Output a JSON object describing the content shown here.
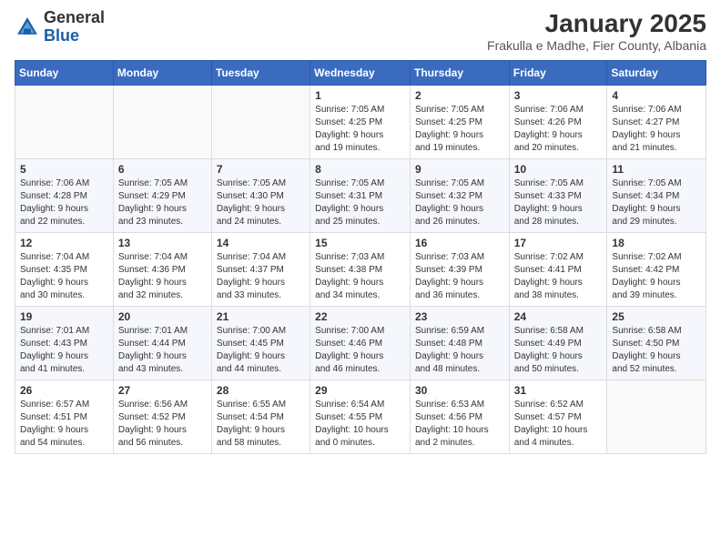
{
  "header": {
    "logo_general": "General",
    "logo_blue": "Blue",
    "month_year": "January 2025",
    "location": "Frakulla e Madhe, Fier County, Albania"
  },
  "days_of_week": [
    "Sunday",
    "Monday",
    "Tuesday",
    "Wednesday",
    "Thursday",
    "Friday",
    "Saturday"
  ],
  "weeks": [
    [
      {
        "day": "",
        "info": ""
      },
      {
        "day": "",
        "info": ""
      },
      {
        "day": "",
        "info": ""
      },
      {
        "day": "1",
        "info": "Sunrise: 7:05 AM\nSunset: 4:25 PM\nDaylight: 9 hours\nand 19 minutes."
      },
      {
        "day": "2",
        "info": "Sunrise: 7:05 AM\nSunset: 4:25 PM\nDaylight: 9 hours\nand 19 minutes."
      },
      {
        "day": "3",
        "info": "Sunrise: 7:06 AM\nSunset: 4:26 PM\nDaylight: 9 hours\nand 20 minutes."
      },
      {
        "day": "4",
        "info": "Sunrise: 7:06 AM\nSunset: 4:27 PM\nDaylight: 9 hours\nand 21 minutes."
      }
    ],
    [
      {
        "day": "5",
        "info": "Sunrise: 7:06 AM\nSunset: 4:28 PM\nDaylight: 9 hours\nand 22 minutes."
      },
      {
        "day": "6",
        "info": "Sunrise: 7:05 AM\nSunset: 4:29 PM\nDaylight: 9 hours\nand 23 minutes."
      },
      {
        "day": "7",
        "info": "Sunrise: 7:05 AM\nSunset: 4:30 PM\nDaylight: 9 hours\nand 24 minutes."
      },
      {
        "day": "8",
        "info": "Sunrise: 7:05 AM\nSunset: 4:31 PM\nDaylight: 9 hours\nand 25 minutes."
      },
      {
        "day": "9",
        "info": "Sunrise: 7:05 AM\nSunset: 4:32 PM\nDaylight: 9 hours\nand 26 minutes."
      },
      {
        "day": "10",
        "info": "Sunrise: 7:05 AM\nSunset: 4:33 PM\nDaylight: 9 hours\nand 28 minutes."
      },
      {
        "day": "11",
        "info": "Sunrise: 7:05 AM\nSunset: 4:34 PM\nDaylight: 9 hours\nand 29 minutes."
      }
    ],
    [
      {
        "day": "12",
        "info": "Sunrise: 7:04 AM\nSunset: 4:35 PM\nDaylight: 9 hours\nand 30 minutes."
      },
      {
        "day": "13",
        "info": "Sunrise: 7:04 AM\nSunset: 4:36 PM\nDaylight: 9 hours\nand 32 minutes."
      },
      {
        "day": "14",
        "info": "Sunrise: 7:04 AM\nSunset: 4:37 PM\nDaylight: 9 hours\nand 33 minutes."
      },
      {
        "day": "15",
        "info": "Sunrise: 7:03 AM\nSunset: 4:38 PM\nDaylight: 9 hours\nand 34 minutes."
      },
      {
        "day": "16",
        "info": "Sunrise: 7:03 AM\nSunset: 4:39 PM\nDaylight: 9 hours\nand 36 minutes."
      },
      {
        "day": "17",
        "info": "Sunrise: 7:02 AM\nSunset: 4:41 PM\nDaylight: 9 hours\nand 38 minutes."
      },
      {
        "day": "18",
        "info": "Sunrise: 7:02 AM\nSunset: 4:42 PM\nDaylight: 9 hours\nand 39 minutes."
      }
    ],
    [
      {
        "day": "19",
        "info": "Sunrise: 7:01 AM\nSunset: 4:43 PM\nDaylight: 9 hours\nand 41 minutes."
      },
      {
        "day": "20",
        "info": "Sunrise: 7:01 AM\nSunset: 4:44 PM\nDaylight: 9 hours\nand 43 minutes."
      },
      {
        "day": "21",
        "info": "Sunrise: 7:00 AM\nSunset: 4:45 PM\nDaylight: 9 hours\nand 44 minutes."
      },
      {
        "day": "22",
        "info": "Sunrise: 7:00 AM\nSunset: 4:46 PM\nDaylight: 9 hours\nand 46 minutes."
      },
      {
        "day": "23",
        "info": "Sunrise: 6:59 AM\nSunset: 4:48 PM\nDaylight: 9 hours\nand 48 minutes."
      },
      {
        "day": "24",
        "info": "Sunrise: 6:58 AM\nSunset: 4:49 PM\nDaylight: 9 hours\nand 50 minutes."
      },
      {
        "day": "25",
        "info": "Sunrise: 6:58 AM\nSunset: 4:50 PM\nDaylight: 9 hours\nand 52 minutes."
      }
    ],
    [
      {
        "day": "26",
        "info": "Sunrise: 6:57 AM\nSunset: 4:51 PM\nDaylight: 9 hours\nand 54 minutes."
      },
      {
        "day": "27",
        "info": "Sunrise: 6:56 AM\nSunset: 4:52 PM\nDaylight: 9 hours\nand 56 minutes."
      },
      {
        "day": "28",
        "info": "Sunrise: 6:55 AM\nSunset: 4:54 PM\nDaylight: 9 hours\nand 58 minutes."
      },
      {
        "day": "29",
        "info": "Sunrise: 6:54 AM\nSunset: 4:55 PM\nDaylight: 10 hours\nand 0 minutes."
      },
      {
        "day": "30",
        "info": "Sunrise: 6:53 AM\nSunset: 4:56 PM\nDaylight: 10 hours\nand 2 minutes."
      },
      {
        "day": "31",
        "info": "Sunrise: 6:52 AM\nSunset: 4:57 PM\nDaylight: 10 hours\nand 4 minutes."
      },
      {
        "day": "",
        "info": ""
      }
    ]
  ]
}
